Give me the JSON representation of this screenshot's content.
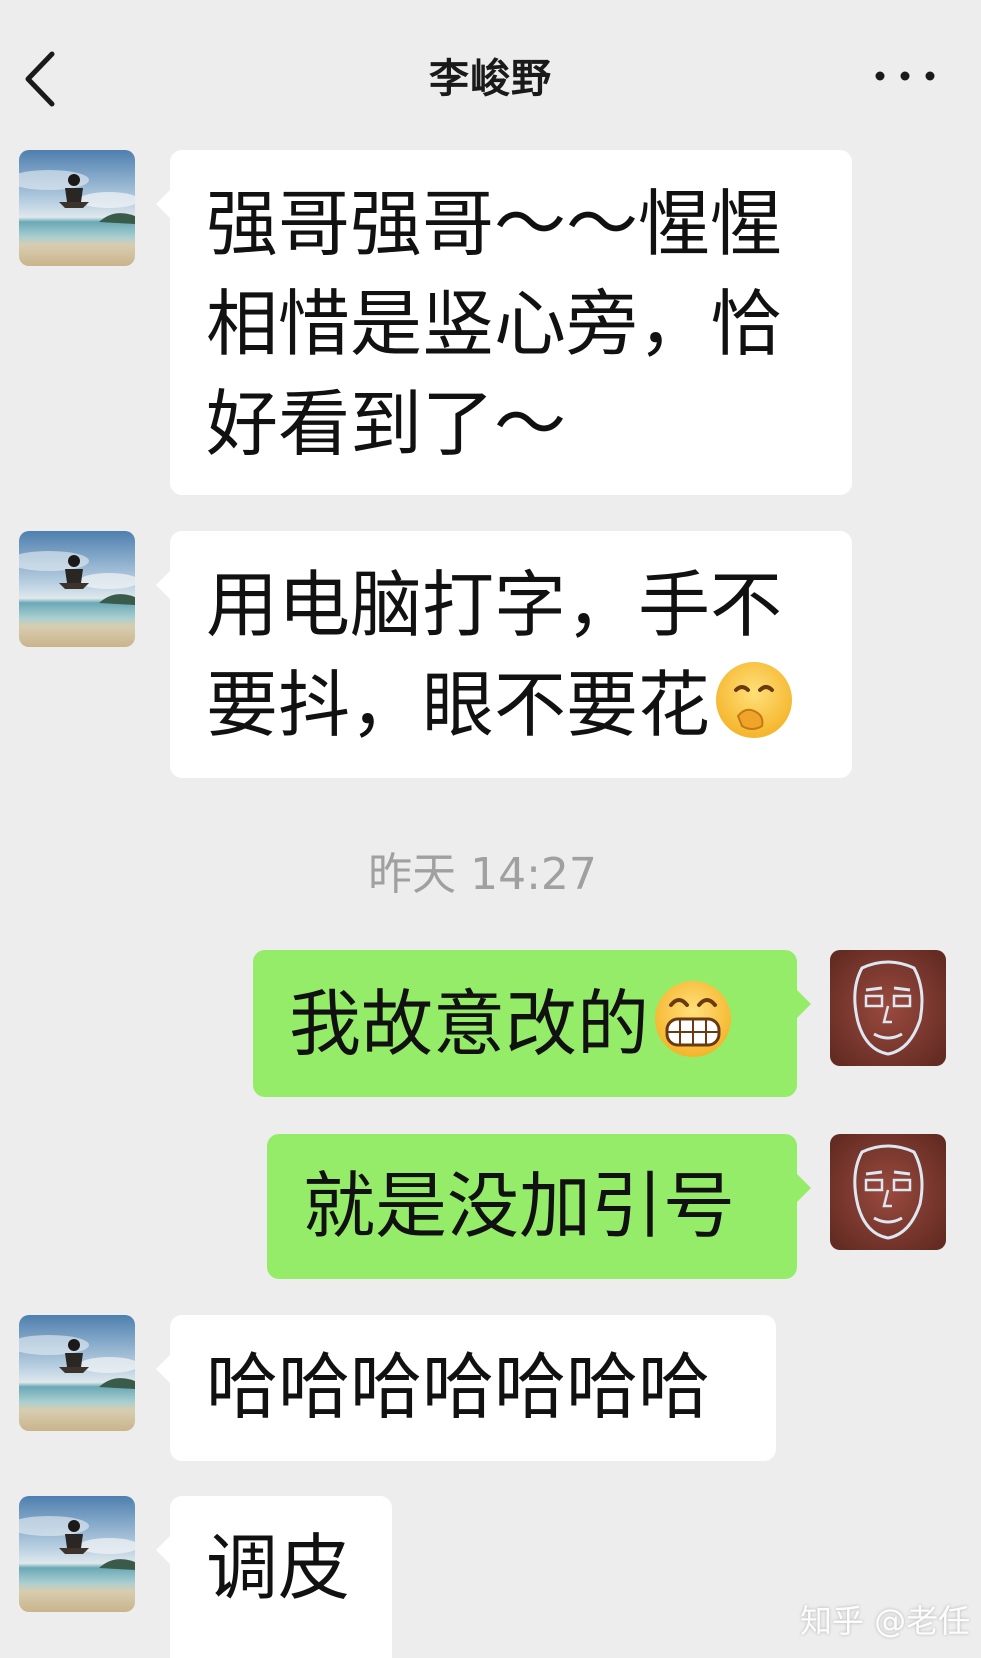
{
  "header": {
    "title": "李峻野",
    "back_icon": "chevron-left-icon",
    "more_icon": "more-horizontal-icon"
  },
  "messages": [
    {
      "sender": "contact",
      "lines": [
        "强哥强哥～～惺惺",
        "相惜是竖心旁，恰",
        "好看到了～"
      ]
    },
    {
      "sender": "contact",
      "lines": [
        "用电脑打字，手不",
        "要抖，眼不要花"
      ],
      "emoji": "covering-mouth-laugh-emoji"
    },
    {
      "sender": "me",
      "lines": [
        "我故意改的"
      ],
      "emoji": "grin-emoji"
    },
    {
      "sender": "me",
      "lines": [
        "就是没加引号"
      ]
    },
    {
      "sender": "contact",
      "lines": [
        "哈哈哈哈哈哈哈"
      ]
    },
    {
      "sender": "contact",
      "lines": [
        "调皮"
      ]
    }
  ],
  "timestamp": "昨天 14:27",
  "watermark": "知乎 @老任",
  "colors": {
    "background": "#ededed",
    "incoming_bubble": "#ffffff",
    "outgoing_bubble": "#95ec69",
    "timestamp_text": "#a0a0a0"
  }
}
